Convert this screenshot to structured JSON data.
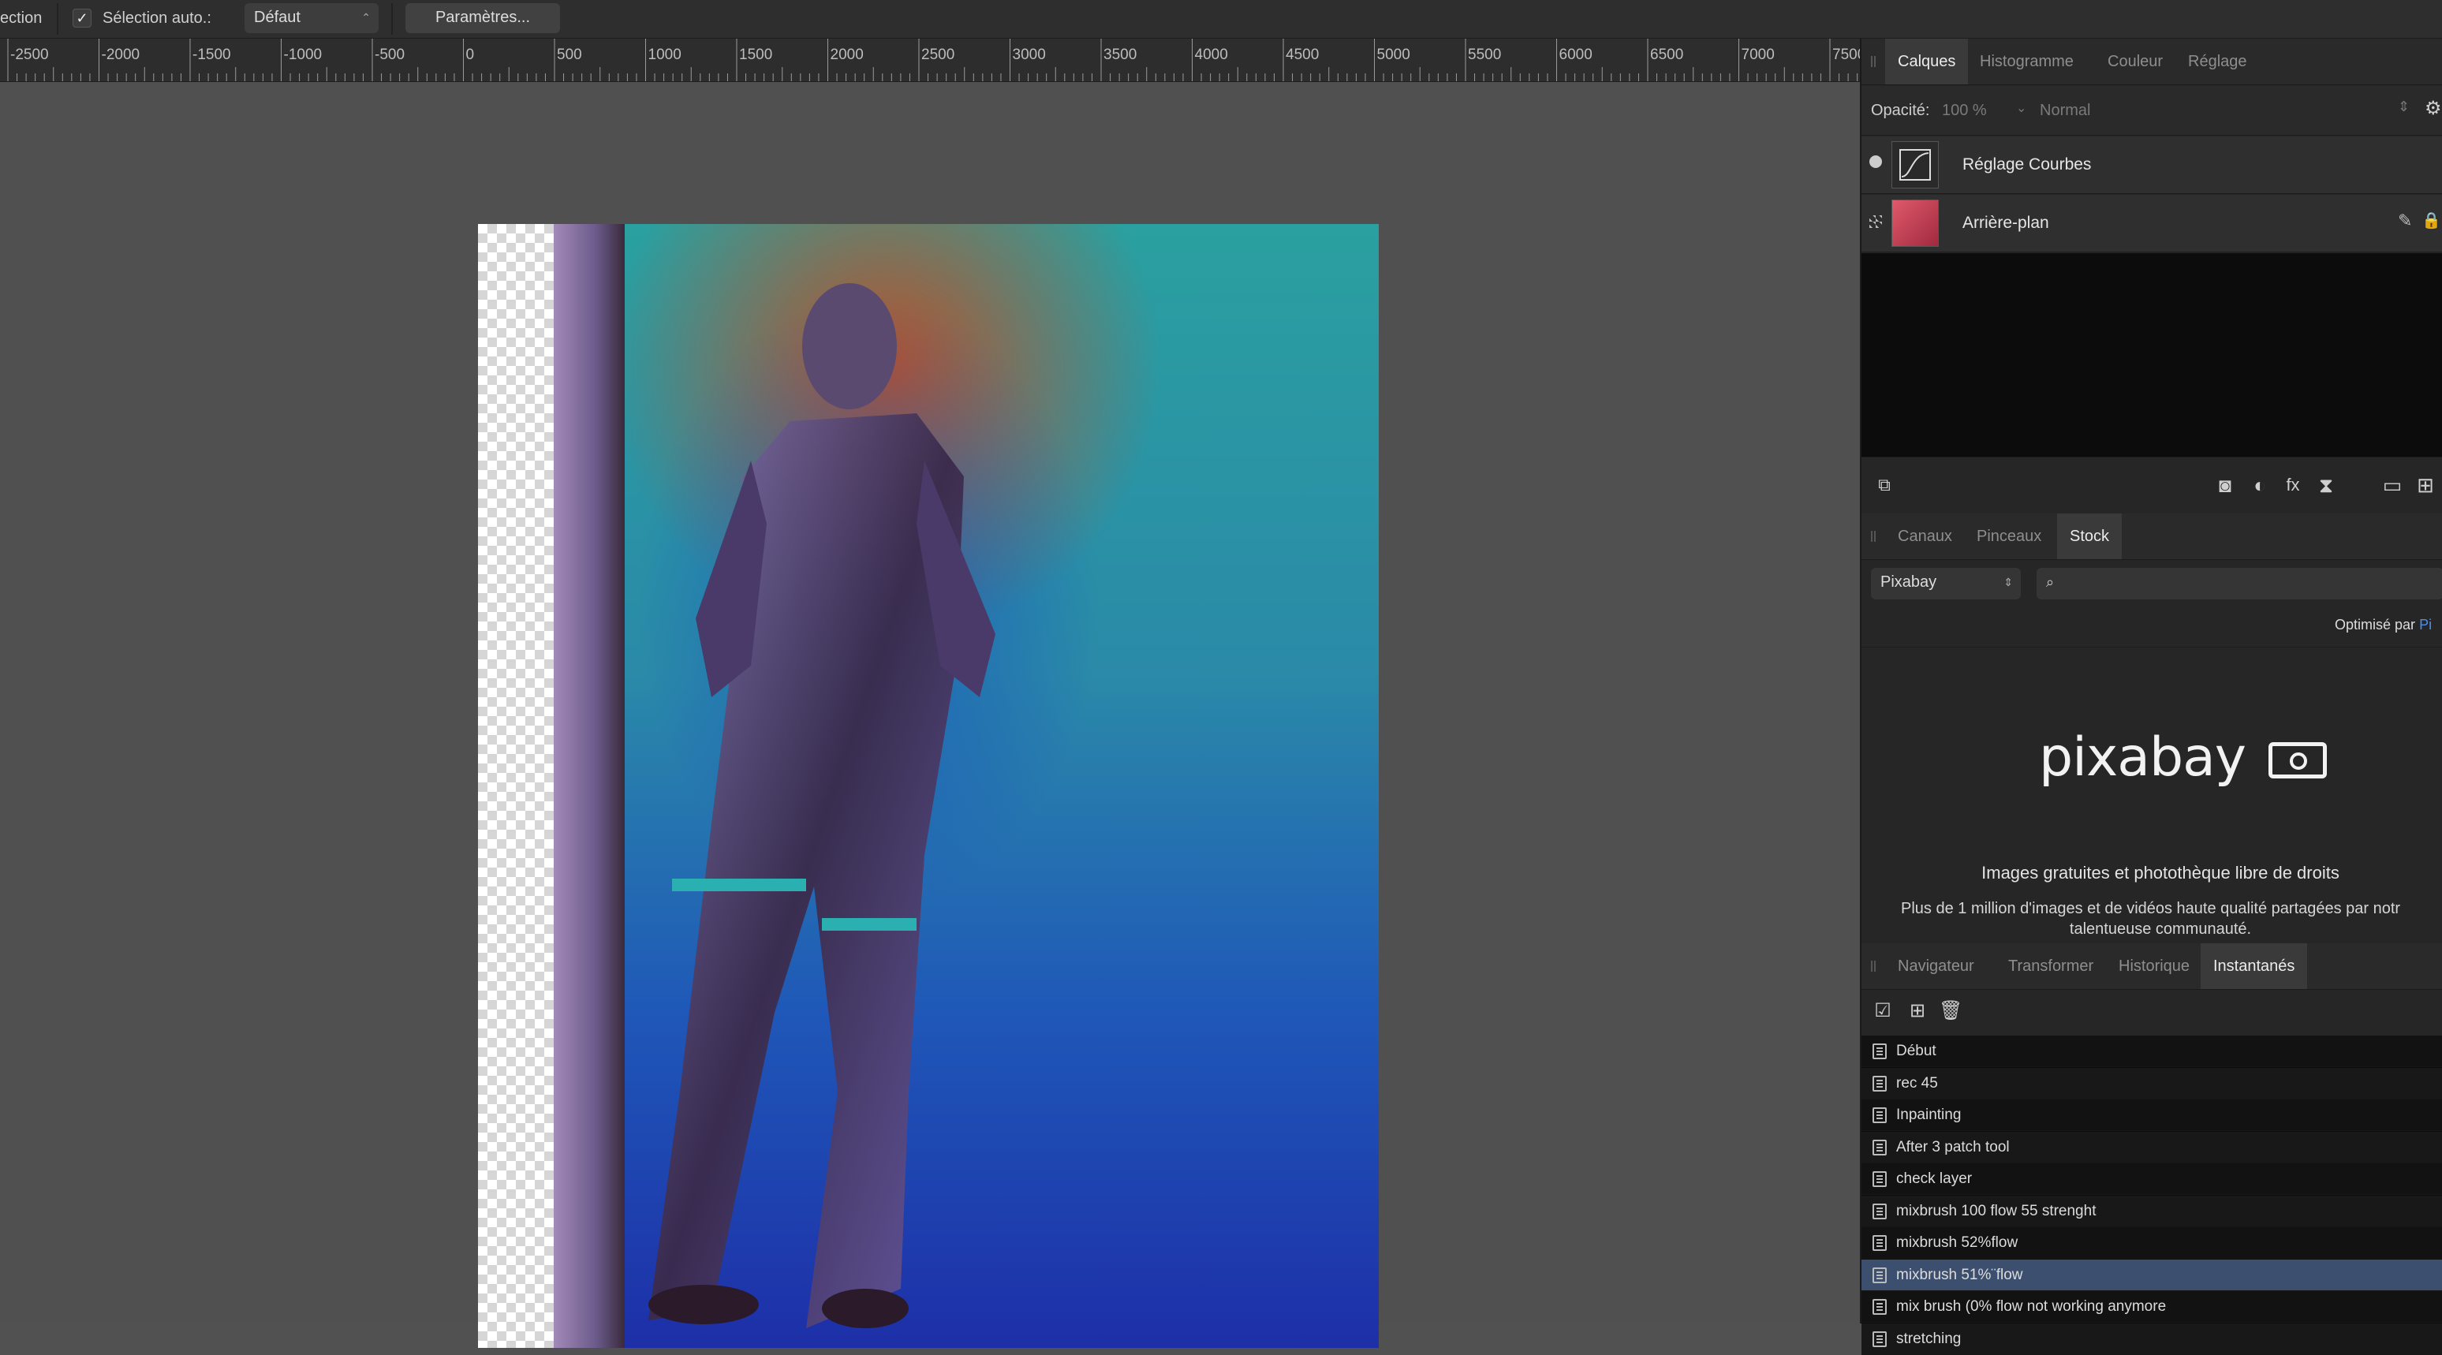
{
  "toolbar": {
    "selection_label": "ection",
    "auto_select_label": "Sélection auto.:",
    "auto_select_checked": true,
    "auto_select_value": "Défaut",
    "params_button": "Paramètres..."
  },
  "ruler": {
    "ticks": [
      "-2500",
      "-2000",
      "-1500",
      "-1000",
      "-500",
      "0",
      "500",
      "1000",
      "1500",
      "2000",
      "2500",
      "3000",
      "3500",
      "4000",
      "4500",
      "5000",
      "5500",
      "6000",
      "6500",
      "7000",
      "7500"
    ]
  },
  "layers_panel": {
    "tabs": [
      "Calques",
      "Histogramme",
      "Couleur",
      "Réglage"
    ],
    "active_tab": "Calques",
    "opacity_label": "Opacité:",
    "opacity_value": "100 %",
    "blend_mode": "Normal",
    "layers": [
      {
        "name": "Réglage Courbes",
        "icon": "curves-icon"
      },
      {
        "name": "Arrière-plan",
        "icon": "image-thumbnail"
      }
    ]
  },
  "stock_panel": {
    "tabs": [
      "Canaux",
      "Pinceaux",
      "Stock"
    ],
    "active_tab": "Stock",
    "provider": "Pixabay",
    "search_placeholder": "",
    "powered_by_prefix": "Optimisé par",
    "powered_by_link": "Pi",
    "logo_text": "pixabay",
    "headline": "Images gratuites et photothèque libre de droits",
    "description_line1": "Plus de 1 million d'images et de vidéos haute qualité partagées par notr",
    "description_line2": "talentueuse communauté."
  },
  "snapshots_panel": {
    "tabs": [
      "Navigateur",
      "Transformer",
      "Historique",
      "Instantanés"
    ],
    "active_tab": "Instantanés",
    "items": [
      "Début",
      "rec 45",
      "Inpainting",
      "After 3 patch tool",
      "check layer",
      "mixbrush 100 flow 55 strenght",
      "mixbrush 52%flow",
      "mixbrush 51%¨flow",
      "mix brush (0% flow not working anymore",
      "stretching"
    ],
    "selected_index": 7
  },
  "colors": {
    "panel_bg": "#262626",
    "canvas_bg": "#505050",
    "selection": "#3d4f6f",
    "link": "#4a8ef0"
  }
}
